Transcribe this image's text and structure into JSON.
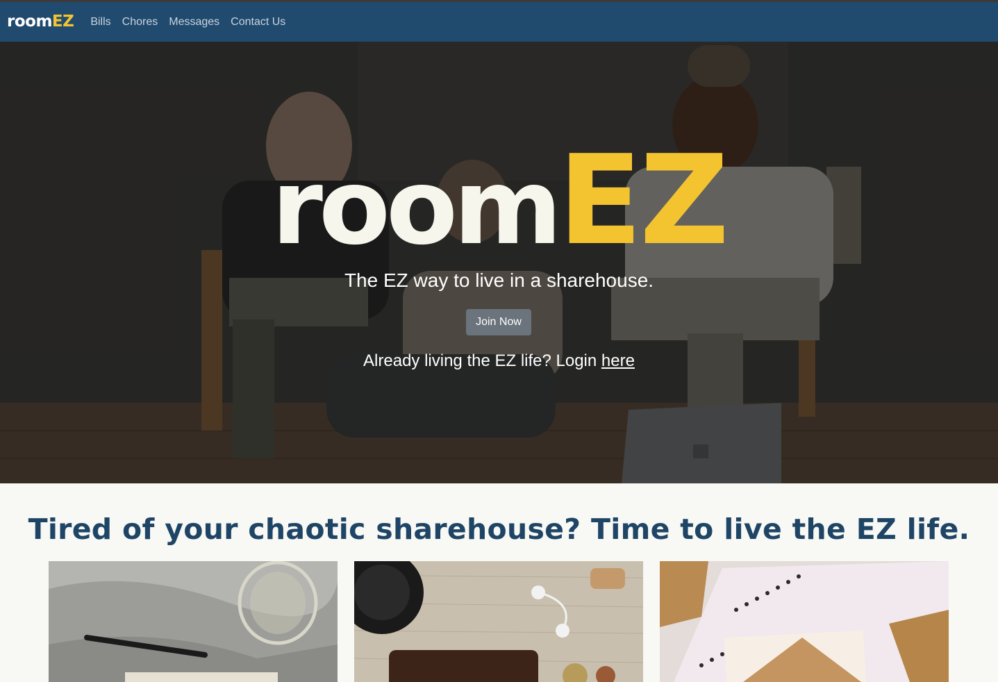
{
  "navbar": {
    "brand_room": "room",
    "brand_ez": "EZ",
    "links": [
      "Bills",
      "Chores",
      "Messages",
      "Contact Us"
    ]
  },
  "hero": {
    "logo_room": "room",
    "logo_ez": "EZ",
    "tagline": "The EZ way to live in a sharehouse.",
    "join_label": "Join Now",
    "login_prefix": "Already living the EZ life? Login ",
    "login_link": "here"
  },
  "section": {
    "title": "Tired of your chaotic sharehouse? Time to live the EZ life."
  },
  "colors": {
    "navbar": "#204a6e",
    "brand_accent": "#f4c430",
    "title": "#1f4566"
  }
}
